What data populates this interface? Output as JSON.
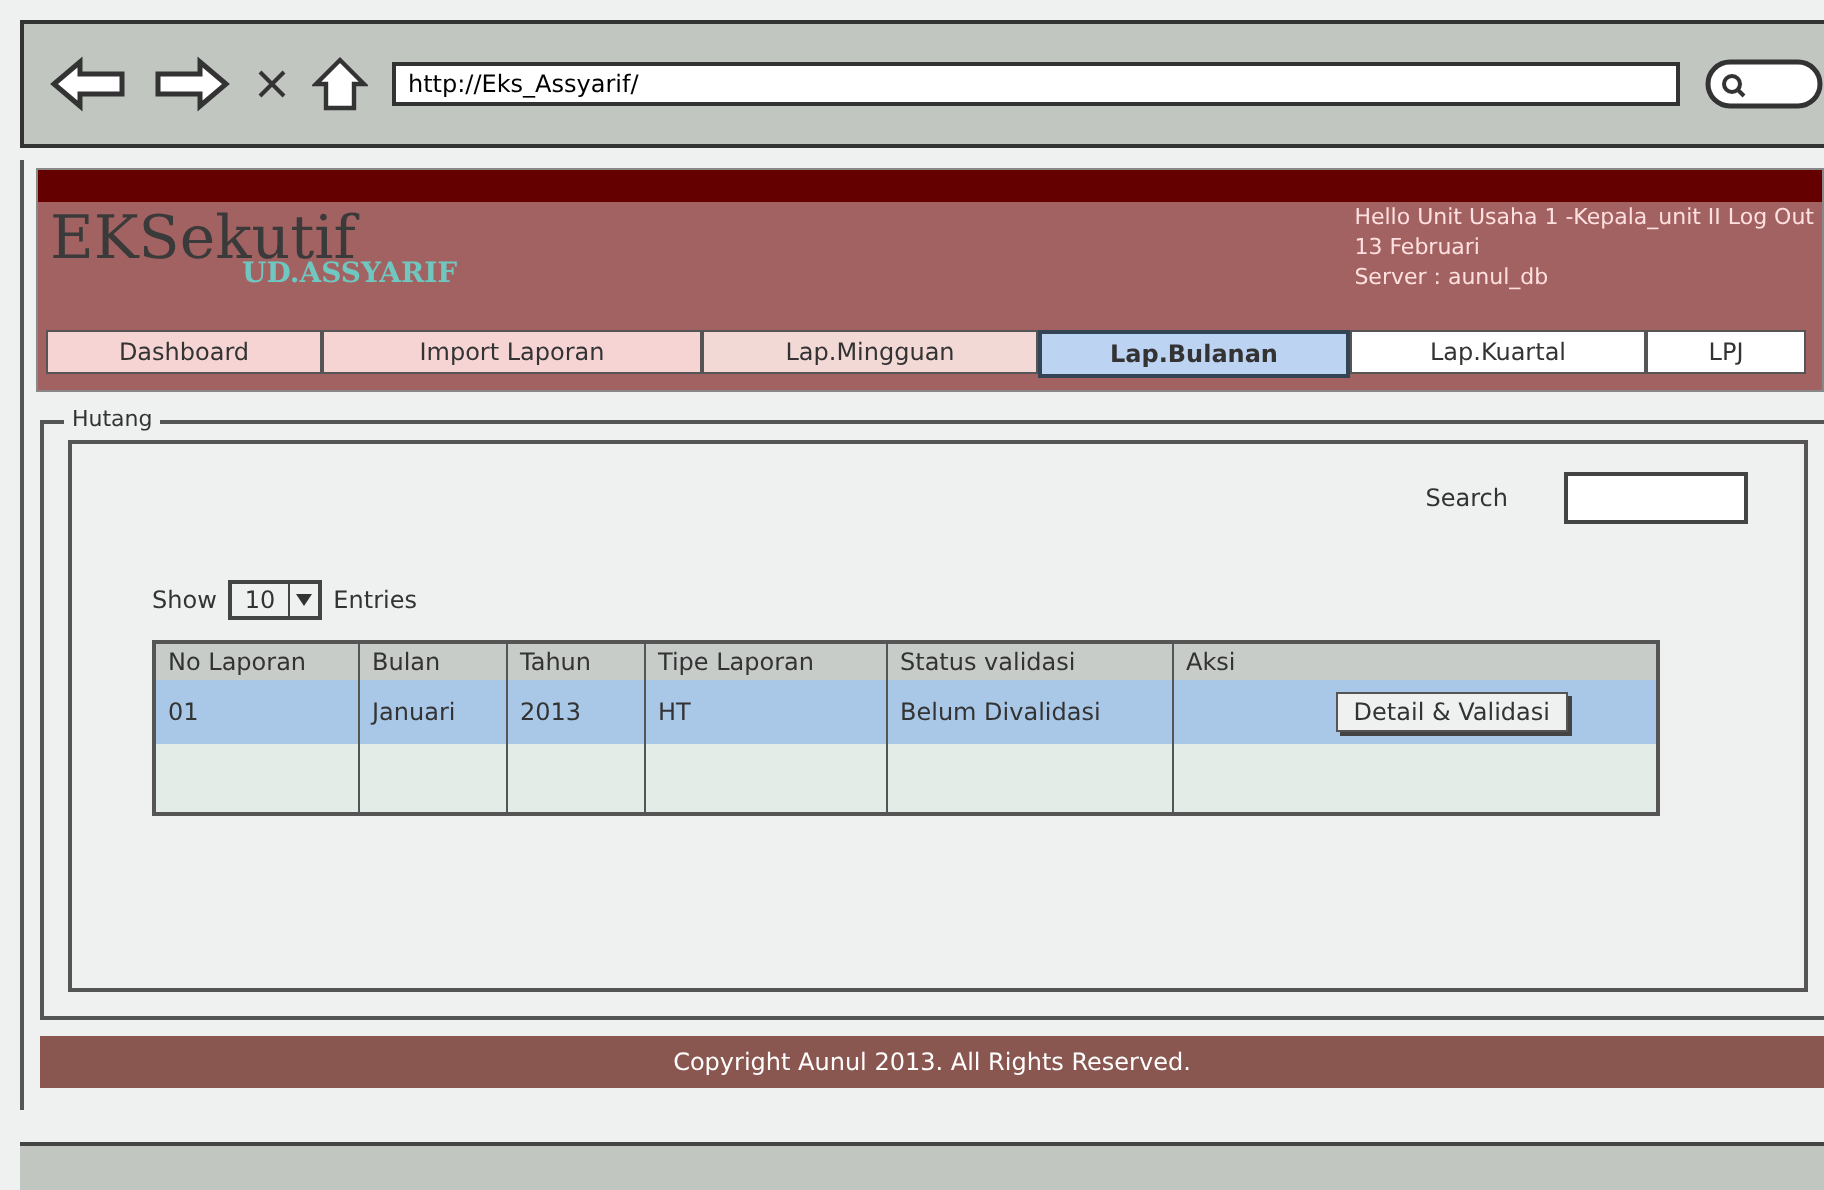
{
  "browser": {
    "url": "http://Eks_Assyarif/"
  },
  "header": {
    "logo": "EKSekutif",
    "company": "UD.ASSYARIF",
    "greeting": "Hello Unit Usaha 1 -Kepala_unit II Log Out",
    "date": "13 Februari",
    "server": "Server : aunul_db"
  },
  "tabs": [
    {
      "label": "Dashboard",
      "selected": false,
      "color": "#f6d4d4"
    },
    {
      "label": "Import Laporan",
      "selected": false,
      "color": "#f6d4d4"
    },
    {
      "label": "Lap.Mingguan",
      "selected": false,
      "color": "#f2d9d6"
    },
    {
      "label": "Lap.Bulanan",
      "selected": true,
      "color": "#bcd3f2"
    },
    {
      "label": "Lap.Kuartal",
      "selected": false,
      "color": "#ffffff"
    },
    {
      "label": "LPJ",
      "selected": false,
      "color": "#ffffff"
    }
  ],
  "panel": {
    "title": "Hutang",
    "search_label": "Search",
    "show_label": "Show",
    "entries_value": "10",
    "entries_label": "Entries"
  },
  "table": {
    "columns": [
      "No Laporan",
      "Bulan",
      "Tahun",
      "Tipe Laporan",
      "Status validasi",
      "Aksi"
    ],
    "rows": [
      {
        "selected": true,
        "cells": [
          "01",
          "Januari",
          "2013",
          "HT",
          "Belum Divalidasi"
        ],
        "action": "Detail & Validasi"
      },
      {
        "selected": false,
        "cells": [
          "",
          "",
          "",
          "",
          ""
        ],
        "action": ""
      }
    ]
  },
  "footer": {
    "text": "Copyright Aunul 2013. All Rights Reserved."
  }
}
